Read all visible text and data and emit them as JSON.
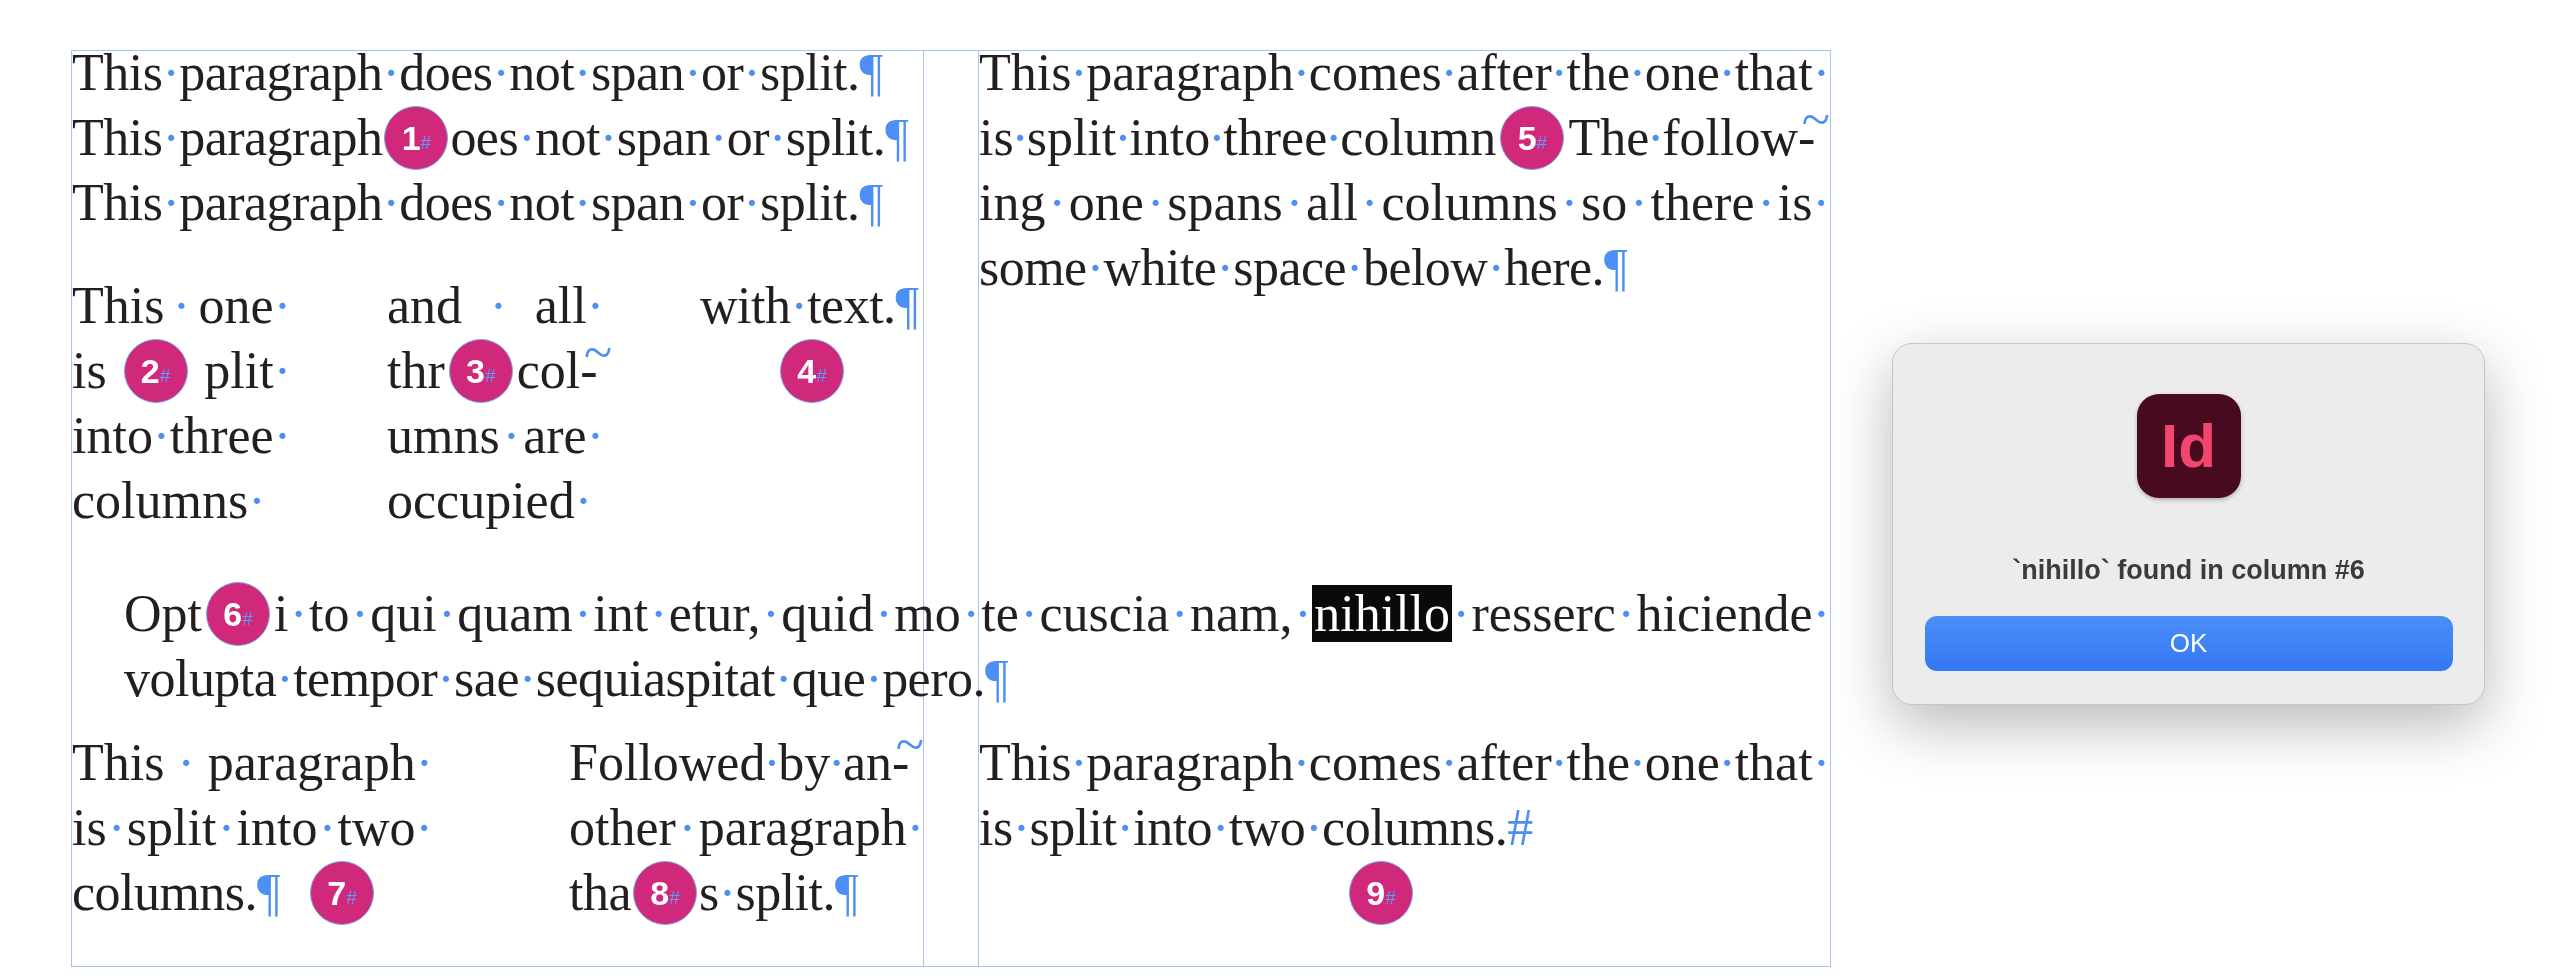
{
  "document": {
    "upper_left": {
      "single_line_paragraphs": [
        {
          "items": [
            {
              "kind": "text",
              "text": "This·paragraph·does·not·span·or·split.¶",
              "selected": false
            }
          ]
        },
        {
          "items": [
            {
              "kind": "text",
              "text": "This·paragraph",
              "selected": false
            },
            {
              "kind": "badge",
              "number": "1",
              "marker": "#"
            },
            {
              "kind": "text",
              "text": "oes·not·span·or·split.¶",
              "selected": false
            }
          ]
        },
        {
          "items": [
            {
              "kind": "text",
              "text": "This·paragraph·does·not·span·or·split.¶",
              "selected": false
            }
          ]
        }
      ],
      "three_column_paragraph": {
        "columns": [
          {
            "lines": [
              {
                "items": [
                  {
                    "kind": "text",
                    "text": "This·one·",
                    "selected": false
                  }
                ]
              },
              {
                "items": [
                  {
                    "kind": "text",
                    "text": "is",
                    "selected": false
                  },
                  {
                    "kind": "badge",
                    "number": "2",
                    "marker": "#"
                  },
                  {
                    "kind": "text",
                    "text": "plit·",
                    "selected": false
                  }
                ]
              },
              {
                "items": [
                  {
                    "kind": "text",
                    "text": "into·three·",
                    "selected": false
                  }
                ]
              },
              {
                "items": [
                  {
                    "kind": "text",
                    "text": "columns·",
                    "selected": false
                  }
                ]
              }
            ]
          },
          {
            "lines": [
              {
                "items": [
                  {
                    "kind": "text",
                    "text": "and · all·",
                    "selected": false
                  }
                ]
              },
              {
                "items": [
                  {
                    "kind": "text",
                    "text": "thr",
                    "selected": false
                  },
                  {
                    "kind": "badge",
                    "number": "3",
                    "marker": "#"
                  },
                  {
                    "kind": "text",
                    "text": "col-~",
                    "selected": false
                  }
                ]
              },
              {
                "items": [
                  {
                    "kind": "text",
                    "text": "umns·are·",
                    "selected": false
                  }
                ]
              },
              {
                "items": [
                  {
                    "kind": "text",
                    "text": "occupied·",
                    "selected": false
                  }
                ]
              }
            ]
          },
          {
            "lines": [
              {
                "items": [
                  {
                    "kind": "text",
                    "text": "with·text.¶",
                    "selected": false
                  }
                ]
              }
            ],
            "badge": {
              "number": "4",
              "marker": "#"
            }
          }
        ]
      }
    },
    "upper_right": {
      "lines": [
        {
          "items": [
            {
              "kind": "text",
              "text": "This·paragraph·comes·after·the·one·that·",
              "selected": false
            }
          ]
        },
        {
          "items": [
            {
              "kind": "text",
              "text": "is·split·into·three·column",
              "selected": false
            },
            {
              "kind": "badge",
              "number": "5",
              "marker": "#"
            },
            {
              "kind": "text",
              "text": "The·follow-~",
              "selected": false
            }
          ]
        },
        {
          "items": [
            {
              "kind": "text",
              "text": "ing·one·spans·all·columns·so·there·is·",
              "selected": false
            }
          ]
        },
        {
          "items": [
            {
              "kind": "text",
              "text": "some·white·space·below·here.¶",
              "selected": false
            }
          ]
        }
      ]
    },
    "spanning_paragraph": {
      "lines": [
        {
          "items": [
            {
              "kind": "text",
              "text": "Opt",
              "selected": false
            },
            {
              "kind": "badge",
              "number": "6",
              "marker": "#"
            },
            {
              "kind": "text",
              "text": "i·to·qui·quam·int·etur,·quid·mo·te·cuscia·nam,·",
              "selected": false
            },
            {
              "kind": "text",
              "text": "nihillo",
              "selected": true
            },
            {
              "kind": "text",
              "text": "·resserc·hiciende·",
              "selected": false
            }
          ]
        },
        {
          "items": [
            {
              "kind": "text",
              "text": "volupta·tempor·sae·sequiaspitat·que·pero.¶",
              "selected": false
            }
          ]
        }
      ]
    },
    "lower_left": {
      "two_column_paragraphs": [
        {
          "lines": [
            {
              "items": [
                {
                  "kind": "text",
                  "text": "This · paragraph·",
                  "selected": false
                }
              ]
            },
            {
              "items": [
                {
                  "kind": "text",
                  "text": "is·split·into·two·",
                  "selected": false
                }
              ]
            },
            {
              "items": [
                {
                  "kind": "text",
                  "text": "columns.¶",
                  "selected": false
                },
                {
                  "kind": "badge",
                  "number": "7",
                  "marker": "#"
                }
              ]
            }
          ]
        },
        {
          "lines": [
            {
              "items": [
                {
                  "kind": "text",
                  "text": "Followed·by·an-~",
                  "selected": false
                }
              ]
            },
            {
              "items": [
                {
                  "kind": "text",
                  "text": "other·paragraph·",
                  "selected": false
                }
              ]
            },
            {
              "items": [
                {
                  "kind": "text",
                  "text": "tha",
                  "selected": false
                },
                {
                  "kind": "badge",
                  "number": "8",
                  "marker": "#"
                },
                {
                  "kind": "text",
                  "text": "s·split.¶",
                  "selected": false
                }
              ]
            }
          ]
        }
      ]
    },
    "lower_right": {
      "lines": [
        {
          "items": [
            {
              "kind": "text",
              "text": "This·paragraph·comes·after·the·one·that·",
              "selected": false
            }
          ]
        },
        {
          "items": [
            {
              "kind": "text",
              "text": "is·split·into·two·columns.#",
              "selected": false
            }
          ]
        }
      ],
      "badge": {
        "number": "9",
        "marker": "#"
      }
    }
  },
  "dialog": {
    "app_logo": "Id",
    "message": "`nihillo` found in column #6",
    "button": "OK"
  }
}
